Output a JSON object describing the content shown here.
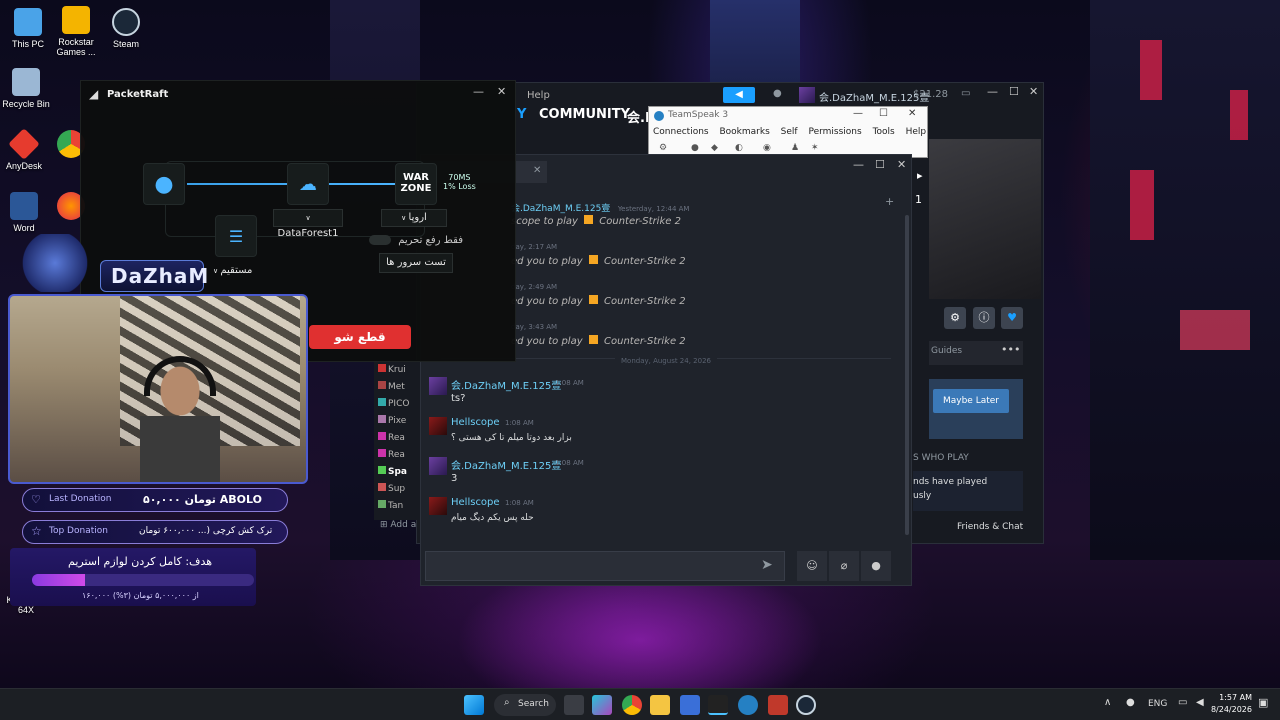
{
  "desktop_icons": [
    {
      "label": "This PC",
      "icon": "monitor-icon",
      "color": "#4aa3e8"
    },
    {
      "label": "Rockstar Games ...",
      "icon": "rockstar-icon",
      "color": "#f4b400"
    },
    {
      "label": "Steam",
      "icon": "steam-icon",
      "color": "#1b2838"
    },
    {
      "label": "Recycle Bin",
      "icon": "recycle-bin-icon",
      "color": "#9bb7d4"
    },
    {
      "label": "AnyDesk",
      "icon": "anydesk-icon",
      "color": "#e63b2e"
    },
    {
      "label": "Word",
      "icon": "word-icon",
      "color": "#2b5797"
    },
    {
      "label": "KMPlayer 64X",
      "icon": "kmplayer-icon",
      "color": "#7a3ff2"
    }
  ],
  "packetraft": {
    "title": "PacketRaft",
    "ping": "70MS",
    "loss": "1% Loss",
    "server": "DataForest1",
    "region": "اروپا",
    "mode": "مستقیم",
    "sanction_only": "فقط رفع تحریم",
    "test_servers": "تست سرور ها",
    "disconnect": "قطع شو",
    "game_logo_line1": "WAR",
    "game_logo_line2": "ZONE"
  },
  "steam": {
    "menu_help": "Help",
    "tab_library_partial": "Y",
    "tab_community": "COMMUNITY",
    "user_partial": "会.D",
    "account_name": "会.DaZhaM_M.E.125壹",
    "balance": "$21.28",
    "guides": "Guides",
    "maybe_later": "Maybe Later",
    "who_play": "S WHO PLAY",
    "friends_played_1": "nds have played",
    "friends_played_2": "usly",
    "friends_chat": "Friends & Chat",
    "add_partial": "Add a",
    "sidebar_games": [
      "Krui",
      "Met",
      "PICO",
      "Pixe",
      "Rea",
      "Rea",
      "Spa",
      "Sup",
      "Tan"
    ],
    "page_number": "1"
  },
  "teamspeak": {
    "title": "TeamSpeak 3",
    "menu": [
      "Connections",
      "Bookmarks",
      "Self",
      "Permissions",
      "Tools",
      "Help"
    ]
  },
  "chat": {
    "messages_top": [
      {
        "time": "Yesterday, 12:44 AM",
        "prefix": "scope to play",
        "game": "Counter-Strike 2",
        "user": "会.DaZhaM_M.E.125壹"
      },
      {
        "time": "day, 2:17 AM",
        "prefix": "ed you to play",
        "game": "Counter-Strike 2"
      },
      {
        "time": "day, 2:49 AM",
        "prefix": "ed you to play",
        "game": "Counter-Strike 2"
      },
      {
        "time": "day, 3:43 AM",
        "prefix": "ed you to play",
        "game": "Counter-Strike 2"
      }
    ],
    "date_divider": "Monday, August 24, 2026",
    "messages": [
      {
        "user": "会.DaZhaM_M.E.125壹",
        "time": "1:08 AM",
        "text": "ts?",
        "color": "#6dcff6"
      },
      {
        "user": "Hellscope",
        "time": "1:08 AM",
        "text": "بزار بعد دوتا میلم تا کی هستی ؟",
        "color": "#6dcff6"
      },
      {
        "user": "会.DaZhaM_M.E.125壹",
        "time": "1:08 AM",
        "text": "3",
        "color": "#6dcff6"
      },
      {
        "user": "Hellscope",
        "time": "1:08 AM",
        "text": "حله پس یکم دیگ میام",
        "color": "#6dcff6"
      }
    ]
  },
  "stream_overlay": {
    "name": "DaZhaM",
    "last_donation_label": "Last Donation",
    "last_donation_value": "۵۰,۰۰۰ تومان  ABOLO",
    "top_donation_label": "Top Donation",
    "top_donation_value": "ترک کش کرچی (... ۶۰۰,۰۰۰ تومان",
    "goal_title": "هدف: کامل کردن لوازم استریم",
    "goal_progress_text": "۱۶۰,۰۰۰ از ۵,۰۰۰,۰۰۰ تومان (۳%)",
    "goal_progress": 0.03
  },
  "taskbar": {
    "search": "Search",
    "lang": "ENG",
    "time": "1:57 AM",
    "date": "8/24/2026",
    "icons": [
      "windows-start-icon",
      "search-icon",
      "task-view-icon",
      "copilot-icon",
      "chrome-icon",
      "file-explorer-icon",
      "store-icon",
      "packetraft-icon",
      "teamspeak-icon",
      "obs-icon",
      "steam-icon"
    ]
  }
}
